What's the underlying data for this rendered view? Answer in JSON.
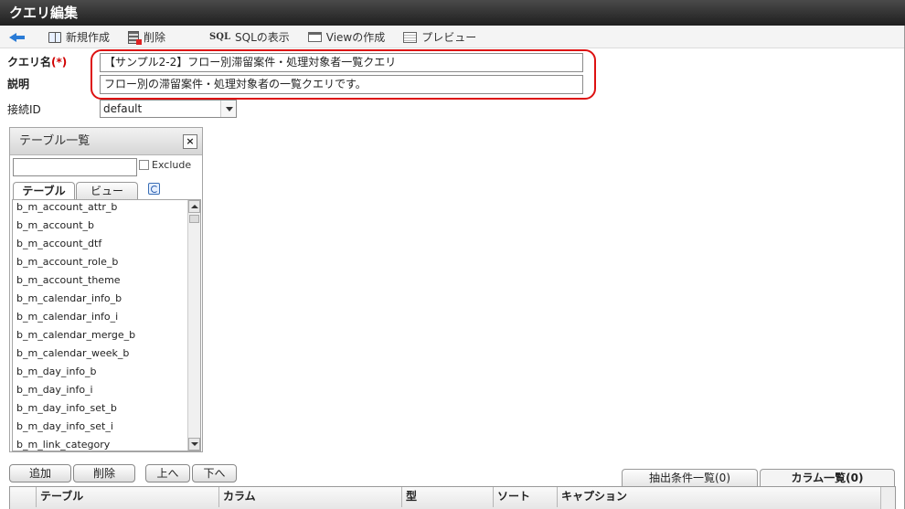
{
  "window": {
    "title": "クエリ編集"
  },
  "toolbar": {
    "new_label": "新規作成",
    "delete_label": "削除",
    "sql_icon_text": "SQL",
    "sql_label": "SQLの表示",
    "view_label": "Viewの作成",
    "preview_label": "プレビュー"
  },
  "form": {
    "query_name_label": "クエリ名",
    "required_mark": "(*)",
    "query_name_value": "【サンプル2-2】フロー別滞留案件・処理対象者一覧クエリ",
    "description_label": "説明",
    "description_value": "フロー別の滞留案件・処理対象者の一覧クエリです。",
    "connection_label": "接続ID",
    "connection_value": "default"
  },
  "table_panel": {
    "title": "テーブル一覧",
    "close_glyph": "×",
    "exclude_label": "Exclude",
    "tabs": [
      "テーブル",
      "ビュー"
    ],
    "items": [
      "b_m_account_attr_b",
      "b_m_account_b",
      "b_m_account_dtf",
      "b_m_account_role_b",
      "b_m_account_theme",
      "b_m_calendar_info_b",
      "b_m_calendar_info_i",
      "b_m_calendar_merge_b",
      "b_m_calendar_week_b",
      "b_m_day_info_b",
      "b_m_day_info_i",
      "b_m_day_info_set_b",
      "b_m_day_info_set_i",
      "b_m_link_category"
    ]
  },
  "actions": {
    "add": "追加",
    "delete": "削除",
    "up": "上へ",
    "down": "下へ"
  },
  "bottom_tabs": {
    "conditions": "抽出条件一覧(0)",
    "columns": "カラム一覧(0)"
  },
  "grid": {
    "headers": [
      "テーブル",
      "カラム",
      "型",
      "ソート",
      "キャプション"
    ]
  }
}
